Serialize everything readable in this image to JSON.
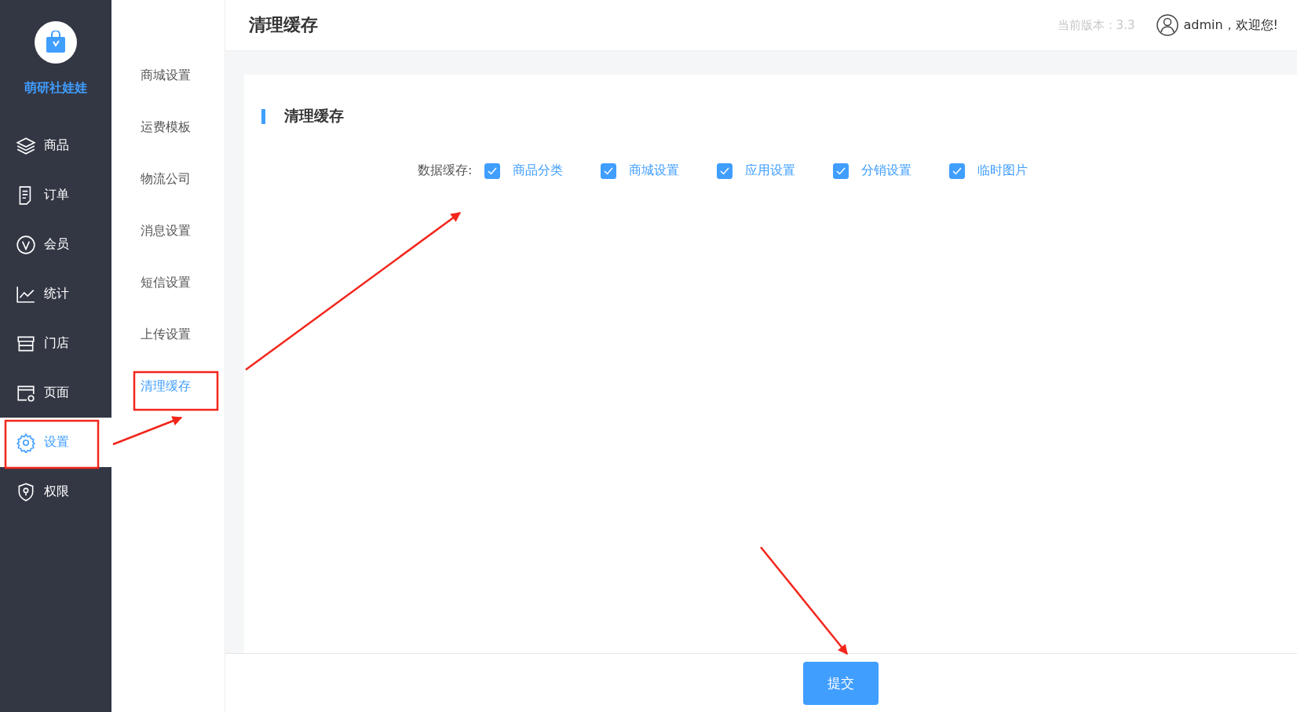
{
  "sidebar": {
    "brand": "萌研社娃娃",
    "items": [
      {
        "label": "商品",
        "selected": false
      },
      {
        "label": "订单",
        "selected": false
      },
      {
        "label": "会员",
        "selected": false
      },
      {
        "label": "统计",
        "selected": false
      },
      {
        "label": "门店",
        "selected": false
      },
      {
        "label": "页面",
        "selected": false
      },
      {
        "label": "设置",
        "selected": true
      },
      {
        "label": "权限",
        "selected": false
      }
    ]
  },
  "submenu": {
    "items": [
      {
        "label": "商城设置",
        "selected": false
      },
      {
        "label": "运费模板",
        "selected": false
      },
      {
        "label": "物流公司",
        "selected": false
      },
      {
        "label": "消息设置",
        "selected": false
      },
      {
        "label": "短信设置",
        "selected": false
      },
      {
        "label": "上传设置",
        "selected": false
      },
      {
        "label": "清理缓存",
        "selected": true
      }
    ]
  },
  "header": {
    "title": "清理缓存",
    "version": "当前版本：3.3",
    "user": "admin，欢迎您!"
  },
  "section": {
    "title": "清理缓存",
    "field_label": "数据缓存:",
    "options": [
      {
        "label": "商品分类",
        "checked": true
      },
      {
        "label": "商城设置",
        "checked": true
      },
      {
        "label": "应用设置",
        "checked": true
      },
      {
        "label": "分销设置",
        "checked": true
      },
      {
        "label": "临时图片",
        "checked": true
      }
    ]
  },
  "footer": {
    "submit": "提交"
  }
}
